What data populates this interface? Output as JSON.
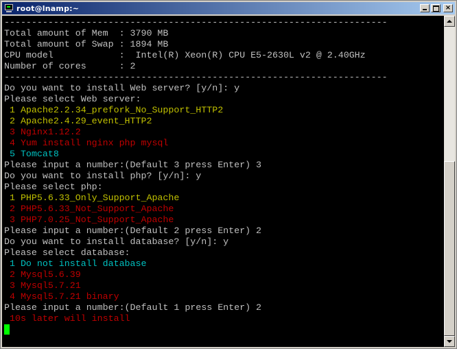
{
  "window": {
    "title": "root@lnamp:~",
    "icon": "terminal-icon",
    "controls": {
      "minimize": "minimize-icon",
      "maximize": "maximize-icon",
      "close": "×"
    }
  },
  "colors": {
    "background": "#000000",
    "default_text": "#c0c0c0",
    "yellow": "#c0c000",
    "red": "#c00000",
    "cyan": "#00c0c0",
    "cursor": "#00ff00"
  },
  "terminal": {
    "lines": [
      {
        "text": "----------------------------------------------------------------------",
        "color": "gray"
      },
      {
        "text": "Total amount of Mem  : 3790 MB",
        "color": "gray"
      },
      {
        "text": "Total amount of Swap : 1894 MB",
        "color": "gray"
      },
      {
        "text": "CPU model            :  Intel(R) Xeon(R) CPU E5-2630L v2 @ 2.40GHz",
        "color": "gray"
      },
      {
        "text": "Number of cores      : 2",
        "color": "gray"
      },
      {
        "text": "----------------------------------------------------------------------",
        "color": "gray"
      },
      {
        "text": "Do you want to install Web server? [y/n]: y",
        "color": "gray"
      },
      {
        "text": "Please select Web server:",
        "color": "gray"
      },
      {
        "text": " 1 Apache2.2.34_prefork_No_Support_HTTP2",
        "color": "yellow"
      },
      {
        "text": " 2 Apache2.4.29_event_HTTP2",
        "color": "yellow"
      },
      {
        "text": " 3 Nginx1.12.2",
        "color": "red"
      },
      {
        "text": " 4 Yum install nginx php mysql",
        "color": "red"
      },
      {
        "text": " 5 Tomcat8",
        "color": "cyan"
      },
      {
        "text": "Please input a number:(Default 3 press Enter) 3",
        "color": "gray"
      },
      {
        "text": "Do you want to install php? [y/n]: y",
        "color": "gray"
      },
      {
        "text": "Please select php:",
        "color": "gray"
      },
      {
        "text": " 1 PHP5.6.33_Only_Support_Apache",
        "color": "yellow"
      },
      {
        "text": " 2 PHP5.6.33_Not_Support_Apache",
        "color": "red"
      },
      {
        "text": " 3 PHP7.0.25_Not_Support_Apache",
        "color": "red"
      },
      {
        "text": "Please input a number:(Default 2 press Enter) 2",
        "color": "gray"
      },
      {
        "text": "Do you want to install database? [y/n]: y",
        "color": "gray"
      },
      {
        "text": "Please select database:",
        "color": "gray"
      },
      {
        "text": " 1 Do not install database",
        "color": "cyan"
      },
      {
        "text": " 2 Mysql5.6.39",
        "color": "red"
      },
      {
        "text": " 3 Mysql5.7.21",
        "color": "red"
      },
      {
        "text": " 4 Mysql5.7.21 binary",
        "color": "red"
      },
      {
        "text": "Please input a number:(Default 1 press Enter) 2",
        "color": "gray"
      },
      {
        "text": " 10s later will install",
        "color": "red"
      }
    ]
  },
  "scrollbar": {
    "up": "arrow-up-icon",
    "down": "arrow-down-icon",
    "position": 0.84
  }
}
